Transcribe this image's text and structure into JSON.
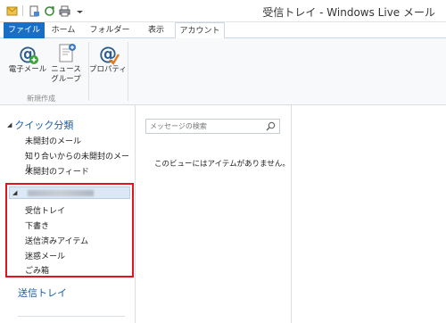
{
  "window": {
    "title": "受信トレイ - Windows Live メール"
  },
  "quick_access": [
    "app-icon",
    "new-message-icon",
    "sync-icon",
    "print-icon",
    "dropdown-icon"
  ],
  "tabs": [
    {
      "label": "ファイル"
    },
    {
      "label": "ホーム"
    },
    {
      "label": "フォルダー"
    },
    {
      "label": "表示"
    },
    {
      "label": "アカウント"
    }
  ],
  "ribbon": {
    "email_line": "電子メール",
    "newsgroup_line1": "ニュース",
    "newsgroup_line2": "グループ",
    "properties": "プロパティ",
    "group_label": "新規作成"
  },
  "nav": {
    "quick_views_header": "クイック分類",
    "quick_views": [
      "未開封のメール",
      "知り合いからの未開封のメール",
      "未開封のフィード"
    ],
    "account_folders": [
      "受信トレイ",
      "下書き",
      "送信済みアイテム",
      "迷惑メール",
      "ごみ箱"
    ],
    "outbox": "送信トレイ"
  },
  "message_list": {
    "search_placeholder": "メッセージの検索",
    "empty_text": "このビューにはアイテムがありません。"
  },
  "colors": {
    "file_tab": "#1a6fc4",
    "highlight_box": "#e0141e",
    "nav_header": "#1a5fa8"
  }
}
